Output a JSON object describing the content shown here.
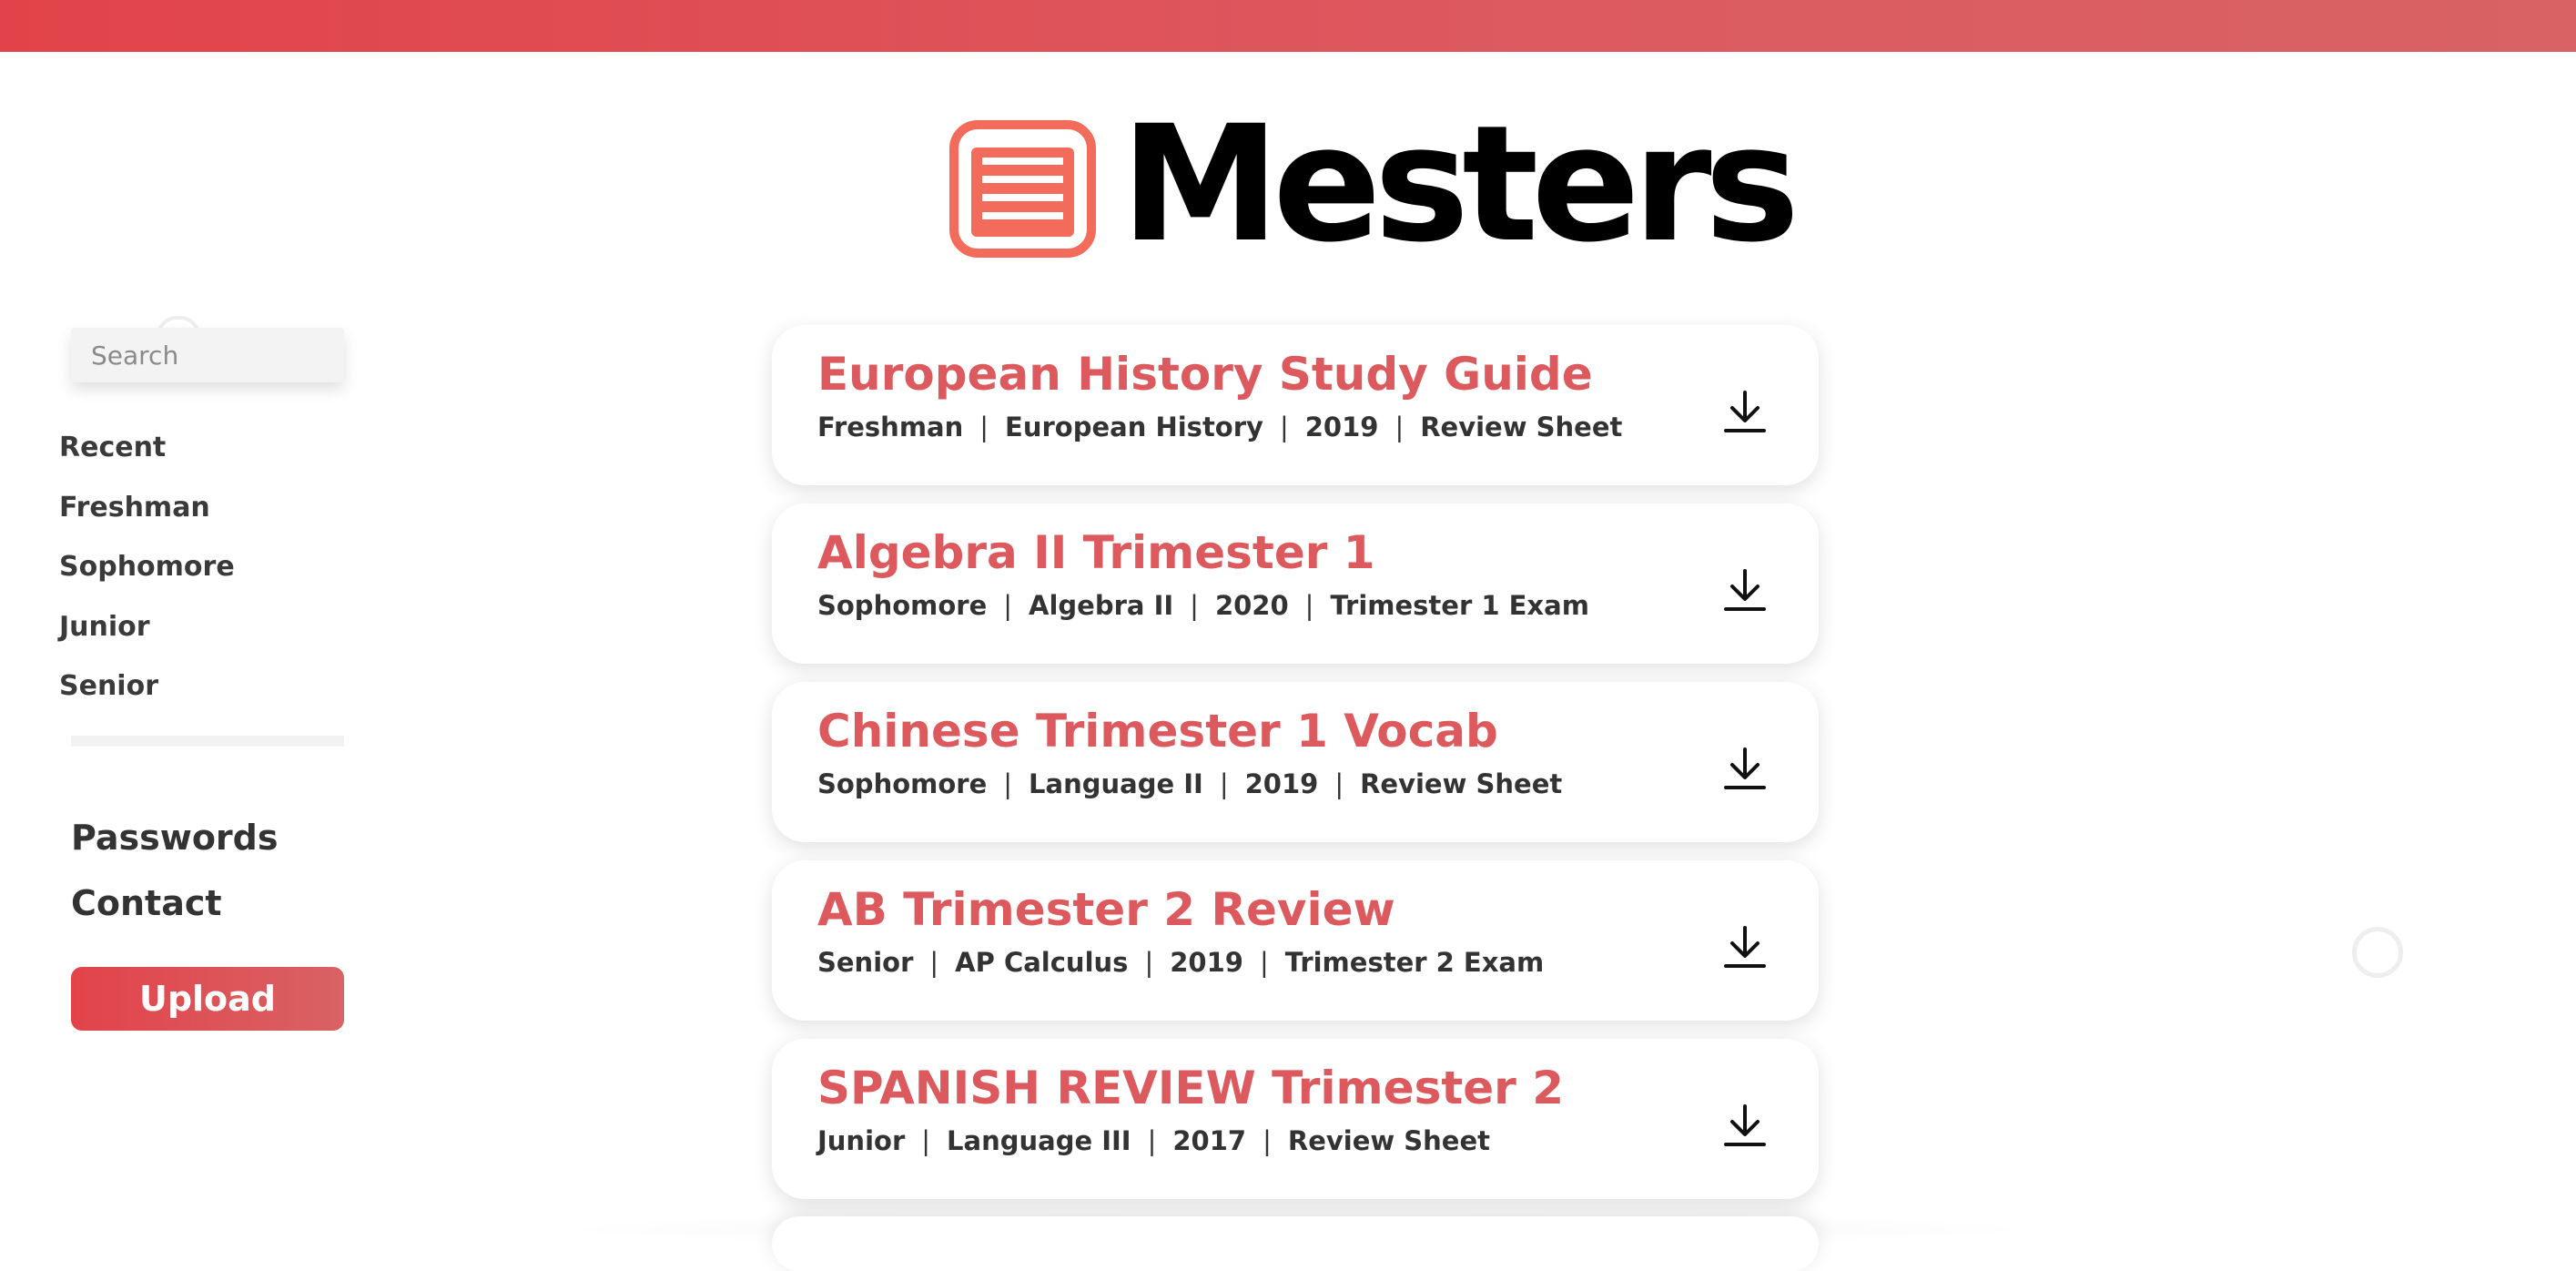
{
  "brand": {
    "name": "Mesters",
    "accent_color": "#dc5a5d",
    "topbar_gradient": [
      "#e2434a",
      "#d86264"
    ]
  },
  "sidebar": {
    "search_placeholder": "Search",
    "nav_items": [
      {
        "label": "Recent"
      },
      {
        "label": "Freshman"
      },
      {
        "label": "Sophomore"
      },
      {
        "label": "Junior"
      },
      {
        "label": "Senior"
      }
    ],
    "secondary_links": [
      {
        "label": "Passwords"
      },
      {
        "label": "Contact"
      }
    ],
    "upload_label": "Upload"
  },
  "documents": [
    {
      "title": "European History Study Guide",
      "grade": "Freshman",
      "subject": "European History",
      "year": "2019",
      "type": "Review Sheet",
      "action_icon": "download-icon"
    },
    {
      "title": "Algebra II Trimester 1",
      "grade": "Sophomore",
      "subject": "Algebra II",
      "year": "2020",
      "type": "Trimester 1 Exam",
      "action_icon": "download-icon"
    },
    {
      "title": "Chinese Trimester 1 Vocab",
      "grade": "Sophomore",
      "subject": "Language II",
      "year": "2019",
      "type": "Review Sheet",
      "action_icon": "download-icon"
    },
    {
      "title": "AB Trimester 2 Review",
      "grade": "Senior",
      "subject": "AP Calculus",
      "year": "2019",
      "type": "Trimester 2 Exam",
      "action_icon": "download-icon"
    },
    {
      "title": "SPANISH REVIEW Trimester 2",
      "grade": "Junior",
      "subject": "Language III",
      "year": "2017",
      "type": "Review Sheet",
      "action_icon": "download-icon"
    }
  ],
  "meta_separator": "|"
}
